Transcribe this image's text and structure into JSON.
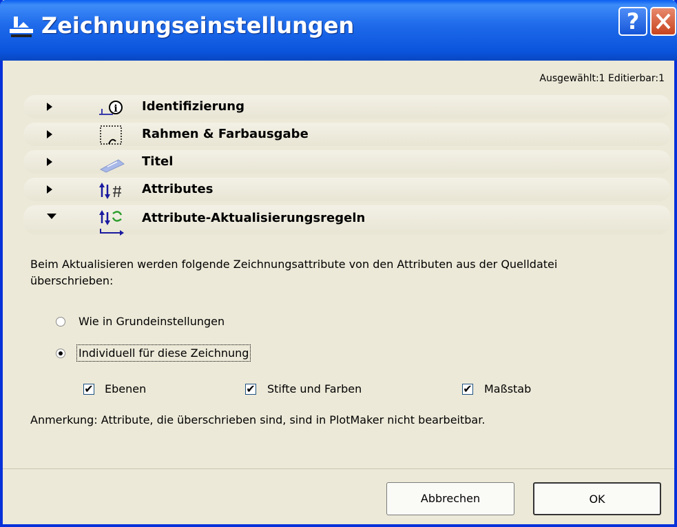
{
  "window": {
    "title": "Zeichnungseinstellungen",
    "help_label": "?"
  },
  "selection_info": "Ausgewählt:1 Editierbar:1",
  "sections": [
    {
      "label": "Identifizierung",
      "icon": "info-icon",
      "expanded": false
    },
    {
      "label": "Rahmen & Farbausgabe",
      "icon": "frame-icon",
      "expanded": false
    },
    {
      "label": "Titel",
      "icon": "title-label-icon",
      "expanded": false
    },
    {
      "label": "Attributes",
      "icon": "attributes-icon",
      "expanded": false
    },
    {
      "label": "Attribute-Aktualisierungsregeln",
      "icon": "attribute-update-icon",
      "expanded": true
    }
  ],
  "update_rules": {
    "description": "Beim Aktualisieren werden folgende Zeichnungsattribute von den Attributen aus der Quelldatei überschrieben:",
    "options": [
      {
        "label": "Wie in Grundeinstellungen",
        "selected": false
      },
      {
        "label": "Individuell für diese Zeichnung",
        "selected": true
      }
    ],
    "checkboxes": [
      {
        "label": "Ebenen",
        "checked": true
      },
      {
        "label": "Stifte und Farben",
        "checked": true
      },
      {
        "label": "Maßstab",
        "checked": true
      }
    ],
    "note": "Anmerkung: Attribute, die überschrieben sind, sind in PlotMaker nicht bearbeitbar."
  },
  "buttons": {
    "cancel": "Abbrechen",
    "ok": "OK"
  },
  "colors": {
    "titlebar": "#0A54DC",
    "background": "#ECE9D8",
    "close": "#C7441F"
  }
}
